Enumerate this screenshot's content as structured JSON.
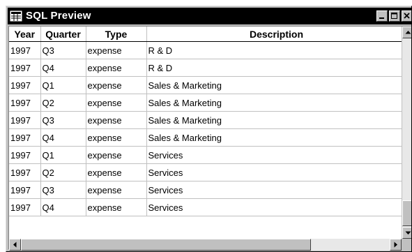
{
  "window": {
    "title": "SQL Preview",
    "icon": "table-grid-icon"
  },
  "grid": {
    "columns": [
      "Year",
      "Quarter",
      "Type",
      "Description"
    ],
    "rows": [
      [
        "1997",
        "Q3",
        "expense",
        "R & D"
      ],
      [
        "1997",
        "Q4",
        "expense",
        "R & D"
      ],
      [
        "1997",
        "Q1",
        "expense",
        "Sales & Marketing"
      ],
      [
        "1997",
        "Q2",
        "expense",
        "Sales & Marketing"
      ],
      [
        "1997",
        "Q3",
        "expense",
        "Sales & Marketing"
      ],
      [
        "1997",
        "Q4",
        "expense",
        "Sales & Marketing"
      ],
      [
        "1997",
        "Q1",
        "expense",
        "Services"
      ],
      [
        "1997",
        "Q2",
        "expense",
        "Services"
      ],
      [
        "1997",
        "Q3",
        "expense",
        "Services"
      ],
      [
        "1997",
        "Q4",
        "expense",
        "Services"
      ]
    ]
  },
  "colors": {
    "titlebar": "#000000",
    "face": "#c0c0c0"
  }
}
